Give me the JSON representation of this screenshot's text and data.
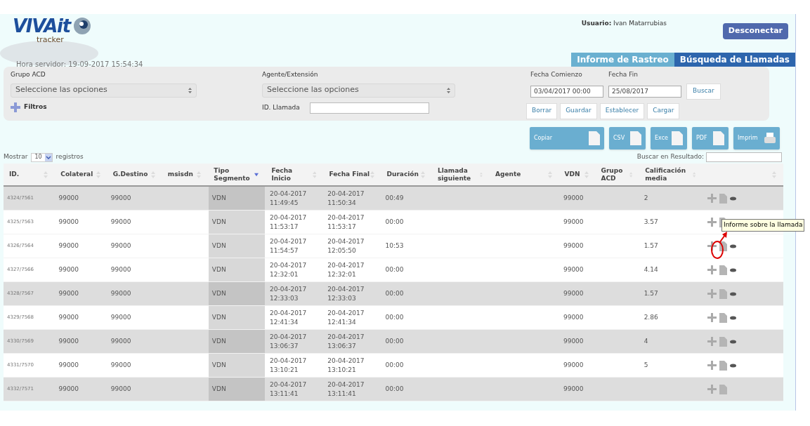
{
  "header": {
    "logo_text": "VIVAit",
    "logo_sub": "tracker",
    "user_label": "Usuario:",
    "user_name": "Ivan Matarrubias",
    "logout": "Desconectar",
    "server_time": "Hora servidor: 19-09-2017 15:54:34"
  },
  "tabs": [
    {
      "label": "Informe de Rastreo",
      "selected": false
    },
    {
      "label": "Búsqueda de Llamadas",
      "selected": true
    }
  ],
  "filters": {
    "grupo_label": "Grupo ACD",
    "grupo_placeholder": "Seleccione las opciones",
    "agente_label": "Agente/Extensión",
    "agente_placeholder": "Seleccione las opciones",
    "filtros": "Filtros",
    "id_label": "ID. Llamada",
    "fecha_comienzo_label": "Fecha Comienzo",
    "fecha_comienzo": "03/04/2017 00:00",
    "fecha_fin_label": "Fecha Fin",
    "fecha_fin": "25/08/2017",
    "buscar": "Buscar",
    "actions": [
      "Borrar",
      "Guardar",
      "Establecer",
      "Cargar"
    ]
  },
  "export_buttons": [
    "Copiar",
    "CSV",
    "Exce",
    "PDF",
    "Imprim"
  ],
  "length_menu": {
    "before": "Mostrar",
    "value": "10",
    "after": "registros"
  },
  "search_label": "Buscar en Resultado:",
  "table": {
    "columns": [
      {
        "label": "ID.",
        "sorted": false
      },
      {
        "label": "Colateral",
        "sorted": false
      },
      {
        "label": "G.Destino",
        "sorted": false
      },
      {
        "label": "msisdn",
        "sorted": false
      },
      {
        "label": "Tipo Segmento",
        "sorted": true
      },
      {
        "label": "Fecha Inicio",
        "sorted": false
      },
      {
        "label": "Fecha Final",
        "sorted": false
      },
      {
        "label": "Duración",
        "sorted": false
      },
      {
        "label": "Llamada siguiente",
        "sorted": false
      },
      {
        "label": "Agente",
        "sorted": false
      },
      {
        "label": "VDN",
        "sorted": false
      },
      {
        "label": "Grupo ACD",
        "sorted": false
      },
      {
        "label": "Calificación media",
        "sorted": false
      },
      {
        "sorted": false
      }
    ],
    "rows": [
      {
        "shaded": true,
        "view": true,
        "cells": [
          "4324/7561",
          "99000",
          "99000",
          "",
          "VDN",
          "20-04-2017 11:49:45",
          "20-04-2017 11:50:34",
          "00:49",
          "",
          "",
          "99000",
          "",
          "2"
        ]
      },
      {
        "shaded": false,
        "cells": [
          "4325/7563",
          "99000",
          "99000",
          "",
          "VDN",
          "20-04-2017 11:53:17",
          "20-04-2017 11:53:17",
          "00:00",
          "",
          "",
          "99000",
          "",
          "3.57"
        ]
      },
      {
        "shaded": false,
        "view": true,
        "cells": [
          "4326/7564",
          "99000",
          "99000",
          "",
          "VDN",
          "20-04-2017 11:54:57",
          "20-04-2017 12:05:50",
          "10:53",
          "",
          "",
          "99000",
          "",
          "1.57"
        ]
      },
      {
        "shaded": false,
        "view": true,
        "cells": [
          "4327/7566",
          "99000",
          "99000",
          "",
          "VDN",
          "20-04-2017 12:32:01",
          "20-04-2017 12:32:01",
          "00:00",
          "",
          "",
          "99000",
          "",
          "4.14"
        ]
      },
      {
        "shaded": true,
        "view": true,
        "cells": [
          "4328/7567",
          "99000",
          "99000",
          "",
          "VDN",
          "20-04-2017 12:33:03",
          "20-04-2017 12:33:03",
          "00:00",
          "",
          "",
          "99000",
          "",
          "1.57"
        ]
      },
      {
        "shaded": false,
        "view": true,
        "cells": [
          "4329/7568",
          "99000",
          "99000",
          "",
          "VDN",
          "20-04-2017 12:41:34",
          "20-04-2017 12:41:34",
          "00:00",
          "",
          "",
          "99000",
          "",
          "2.86"
        ]
      },
      {
        "shaded": true,
        "view": true,
        "cells": [
          "4330/7569",
          "99000",
          "99000",
          "",
          "VDN",
          "20-04-2017 13:06:37",
          "20-04-2017 13:06:37",
          "00:00",
          "",
          "",
          "99000",
          "",
          "4"
        ]
      },
      {
        "shaded": false,
        "view": true,
        "cells": [
          "4331/7570",
          "99000",
          "99000",
          "",
          "VDN",
          "20-04-2017 13:10:21",
          "20-04-2017 13:10:21",
          "00:00",
          "",
          "",
          "99000",
          "",
          "5"
        ]
      },
      {
        "shaded": true,
        "view": false,
        "cells": [
          "4332/7571",
          "99000",
          "99000",
          "",
          "VDN",
          "20-04-2017 13:11:41",
          "20-04-2017 13:11:41",
          "00:00",
          "",
          "",
          "99000",
          "",
          ""
        ]
      }
    ]
  },
  "tooltip": {
    "text": "Informe sobre la llamada"
  }
}
